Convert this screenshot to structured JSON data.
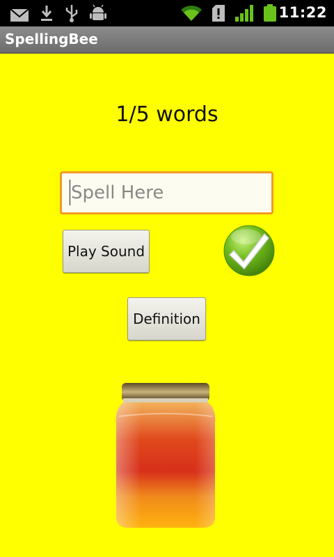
{
  "status_bar": {
    "time": "11:22",
    "icons": [
      "gmail-icon",
      "download-icon",
      "usb-icon",
      "android-debug-icon",
      "wifi-icon",
      "sd-card-icon",
      "signal-icon",
      "battery-icon"
    ]
  },
  "app": {
    "title": "SpellingBee"
  },
  "progress": {
    "text": "1/5 words"
  },
  "spell_input": {
    "value": "",
    "placeholder": "Spell Here"
  },
  "buttons": {
    "play_sound": "Play Sound",
    "definition": "Definition"
  },
  "colors": {
    "background": "#ffff00",
    "input_border": "#f29a23",
    "check": "#5fae10"
  }
}
